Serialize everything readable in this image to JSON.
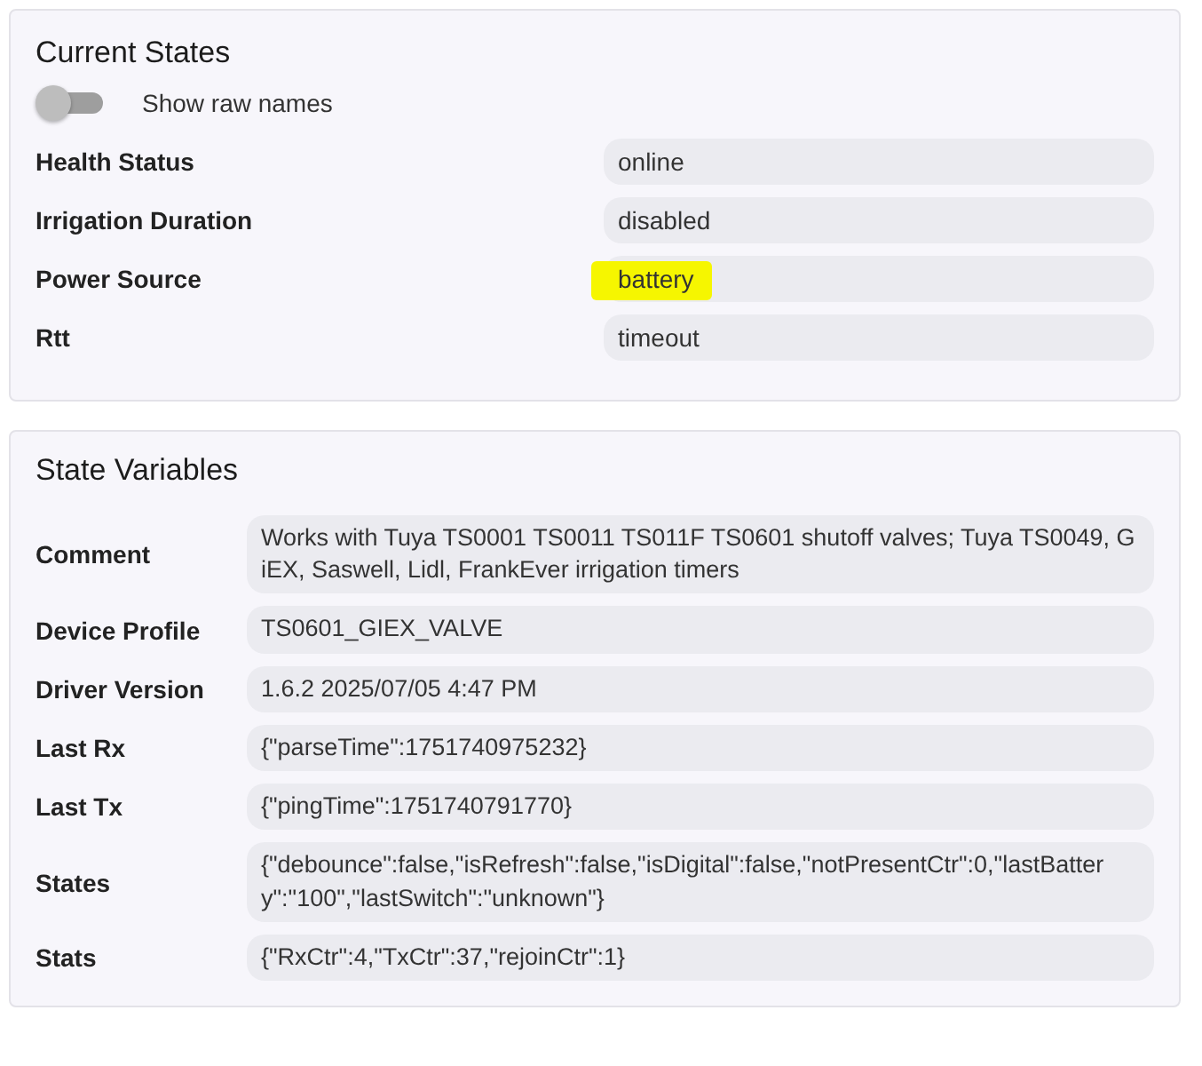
{
  "current_states": {
    "title": "Current States",
    "raw_names_toggle": {
      "label": "Show raw names",
      "on": false
    },
    "rows": [
      {
        "label": "Health Status",
        "value": "online",
        "highlighted": false
      },
      {
        "label": "Irrigation Duration",
        "value": "disabled",
        "highlighted": false
      },
      {
        "label": "Power Source",
        "value": "battery",
        "highlighted": true
      },
      {
        "label": "Rtt",
        "value": "timeout",
        "highlighted": false
      }
    ]
  },
  "state_variables": {
    "title": "State Variables",
    "rows": [
      {
        "label": "Comment",
        "value": "Works with Tuya TS0001 TS0011 TS011F TS0601 shutoff valves; Tuya TS0049, GiEX, Saswell, Lidl, FrankEver irrigation timers"
      },
      {
        "label": "Device Profile",
        "value": "TS0601_GIEX_VALVE"
      },
      {
        "label": "Driver Version",
        "value": "1.6.2 2025/07/05 4:47 PM"
      },
      {
        "label": "Last Rx",
        "value": "{\"parseTime\":1751740975232}"
      },
      {
        "label": "Last Tx",
        "value": "{\"pingTime\":1751740791770}"
      },
      {
        "label": "States",
        "value": "{\"debounce\":false,\"isRefresh\":false,\"isDigital\":false,\"notPresentCtr\":0,\"lastBattery\":\"100\",\"lastSwitch\":\"unknown\"}"
      },
      {
        "label": "Stats",
        "value": "{\"RxCtr\":4,\"TxCtr\":37,\"rejoinCtr\":1}"
      }
    ]
  }
}
